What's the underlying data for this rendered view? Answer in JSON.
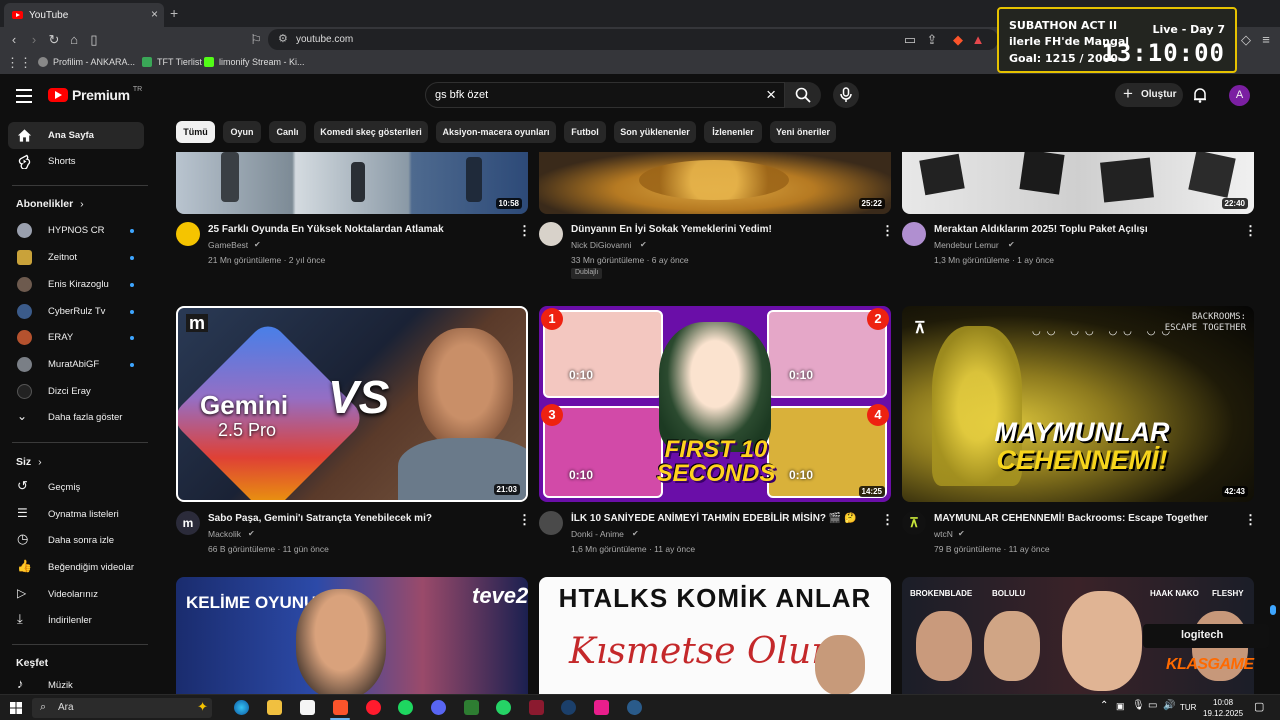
{
  "browser": {
    "tab_title": "YouTube",
    "url": "youtube.com",
    "bookmarks": [
      "Profilim - ANKARA...",
      "TFT Tierlist",
      "limonify Stream - Ki..."
    ]
  },
  "overlay": {
    "title": "SUBATHON ACT II",
    "subtitle": "ilerle FH'de Mangal",
    "goal": "Goal: 1215 / 2000",
    "live": "Live - Day 7",
    "timer": "13:10:00"
  },
  "header": {
    "logo_text": "Premium",
    "logo_region": "TR",
    "search_value": "gs bfk özet",
    "create_label": "Oluştur",
    "avatar_letter": "A"
  },
  "sidebar": {
    "main": [
      {
        "label": "Ana Sayfa",
        "icon": "home-icon"
      },
      {
        "label": "Shorts",
        "icon": "shorts-icon"
      }
    ],
    "subs_header": "Abonelikler",
    "subscriptions": [
      "HYPNOS CR",
      "Zeitnot",
      "Enis Kirazoglu",
      "CyberRulz Tv",
      "ERAY",
      "MuratAbiGF",
      "Dizci Eray"
    ],
    "show_more": "Daha fazla göster",
    "you_header": "Siz",
    "you_items": [
      "Geçmiş",
      "Oynatma listeleri",
      "Daha sonra izle",
      "Beğendiğim videolar",
      "Videolarınız",
      "İndirilenler"
    ],
    "explore_header": "Keşfet",
    "explore_items": [
      "Müzik"
    ]
  },
  "chips": [
    "Tümü",
    "Oyun",
    "Canlı",
    "Komedi skeç gösterileri",
    "Aksiyon-macera oyunları",
    "Futbol",
    "Son yüklenenler",
    "İzlenenler",
    "Yeni öneriler"
  ],
  "videos_row1": [
    {
      "title": "25 Farklı Oyunda En Yüksek Noktalardan Atlamak",
      "channel": "GameBest",
      "meta": "21 Mn görüntüleme · 2 yıl önce",
      "duration": "10:58"
    },
    {
      "title": "Dünyanın En İyi Sokak Yemeklerini Yedim!",
      "channel": "Nick DiGiovanni",
      "meta": "33 Mn görüntüleme · 6 ay önce",
      "duration": "25:22",
      "badge": "Dublajlı"
    },
    {
      "title": "Meraktan Aldıklarım 2025! Toplu Paket Açılışı",
      "channel": "Mendebur Lemur",
      "meta": "1,3 Mn görüntüleme · 1 ay önce",
      "duration": "22:40"
    }
  ],
  "videos_row2": [
    {
      "title": "Sabo Paşa, Gemini'ı Satrançta Yenebilecek mi?",
      "channel": "Mackolik",
      "meta": "66 B görüntüleme · 11 gün önce",
      "duration": "21:03",
      "thumb_text1": "Gemini",
      "thumb_text2": "2.5 Pro",
      "thumb_text3": "VS"
    },
    {
      "title": "İLK 10 SANİYEDE ANİMEYİ TAHMİN EDEBİLİR MİSİN? 🎬 🤔",
      "channel": "Donki - Anime",
      "meta": "1,6 Mn görüntüleme · 11 ay önce",
      "duration": "14:25",
      "thumb_text1": "FIRST 10",
      "thumb_text2": "SECONDS",
      "thumb_time": "0:10"
    },
    {
      "title": "MAYMUNLAR CEHENNEMİ! Backrooms: Escape Together",
      "channel": "wtcN",
      "meta": "79 B görüntüleme · 11 ay önce",
      "duration": "42:43",
      "thumb_text1": "MAYMUNLAR",
      "thumb_text2": "CEHENNEMİ!",
      "thumb_text3": "BACKROOMS:",
      "thumb_text4": "ESCAPE TOGETHER"
    }
  ],
  "videos_row3": [
    {
      "thumb_text1": "KELİME OYUNU",
      "thumb_text2": "teve2"
    },
    {
      "thumb_text1": "HTALKS KOMİK ANLAR",
      "thumb_text2": "Kısmetse Olur"
    },
    {
      "thumb_names": [
        "BROKENBLADE",
        "BOLULU",
        "HAAK NAKO",
        "FLESHY"
      ]
    }
  ],
  "stream_overlay": {
    "sponsor": "logitech",
    "brand": "KLASGAME"
  },
  "taskbar": {
    "search_label": "Ara",
    "lang": "TUR",
    "time": "10:08",
    "date": "19.12.2025"
  }
}
